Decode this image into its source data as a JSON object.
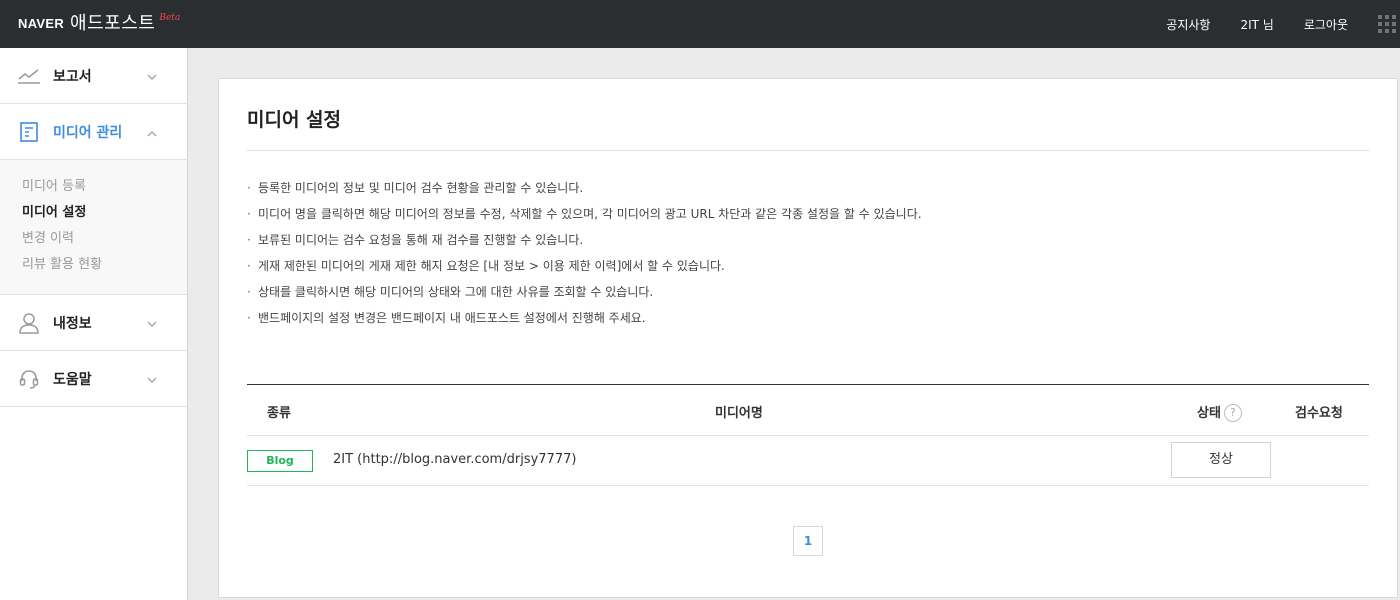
{
  "header": {
    "logo_naver": "NAVER",
    "logo_name": "애드포스트",
    "logo_beta": "Beta",
    "notice_link": "공지사항",
    "user_link": "2IT 님",
    "logout_link": "로그아웃",
    "apps_icon": "grid-icon"
  },
  "sidebar": {
    "menu": [
      {
        "label": "보고서",
        "icon": "chart-line-icon"
      },
      {
        "label": "미디어 관리",
        "icon": "document-icon"
      },
      {
        "label": "내정보",
        "icon": "user-icon"
      },
      {
        "label": "도움말",
        "icon": "headset-icon"
      }
    ],
    "submenu": [
      "미디어 등록",
      "미디어 설정",
      "변경 이력",
      "리뷰 활용 현황"
    ],
    "active_color": "#3b8ee0"
  },
  "main": {
    "title": "미디어 설정",
    "notices": [
      "등록한 미디어의 정보 및 미디어 검수 현황을 관리할 수 있습니다.",
      "미디어 명을 클릭하면 해당 미디어의 정보를 수정, 삭제할 수 있으며, 각 미디어의 광고 URL 차단과 같은 각종 설정을 할 수 있습니다.",
      "보류된 미디어는 검수 요청을 통해 재 검수를 진행할 수 있습니다.",
      "게재 제한된 미디어의 게재 제한 해지 요청은 [내 정보 > 이용 제한 이력]에서 할 수 있습니다.",
      "상태를 클릭하시면 해당 미디어의 상태와 그에 대한 사유를 조회할 수 있습니다.",
      "밴드페이지의 설정 변경은 밴드페이지 내 애드포스트 설정에서 진행해 주세요."
    ],
    "table": {
      "headers": {
        "type": "종류",
        "media": "미디어명",
        "status": "상태",
        "help": "?",
        "review": "검수요청"
      },
      "rows": [
        {
          "type": "Blog",
          "media": "2IT (http://blog.naver.com/drjsy7777)",
          "status": "정상",
          "review": ""
        }
      ]
    },
    "pagination": {
      "current": "1"
    }
  }
}
